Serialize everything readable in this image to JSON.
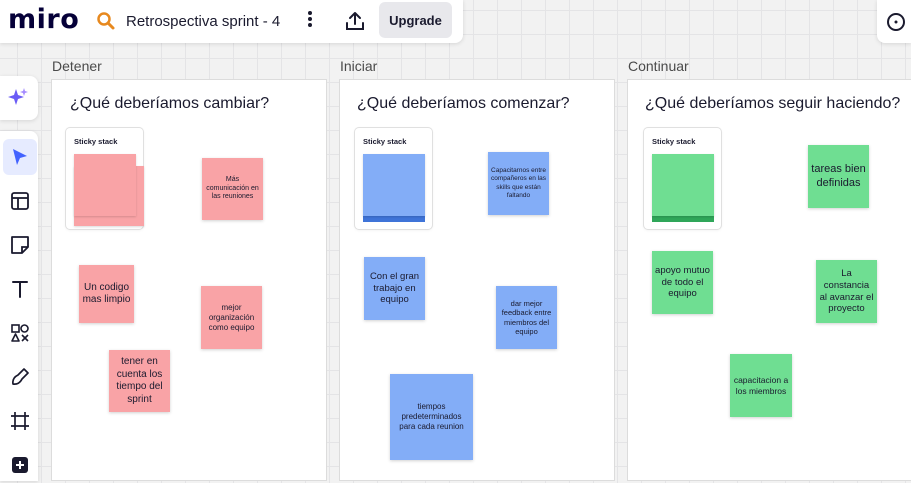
{
  "topbar": {
    "logo": "miro",
    "board_title": "Retrospectiva sprint - 4",
    "upgrade_label": "Upgrade"
  },
  "columns": [
    {
      "label": "Detener",
      "title": "¿Qué deberíamos cambiar?",
      "stack_label": "Sticky stack",
      "notes": [
        "Más comunicación en las reuniones",
        "Un codigo mas limpio",
        "mejor organización como equipo",
        "tener en cuenta los tiempo del sprint"
      ]
    },
    {
      "label": "Iniciar",
      "title": "¿Qué deberíamos comenzar?",
      "stack_label": "Sticky stack",
      "notes": [
        "Capacitarnos entre compañeros en las skills que están faltando",
        "Con el gran trabajo en equipo",
        "dar mejor feedback entre miembros del equipo",
        "tiempos predeterminados para cada reunion"
      ]
    },
    {
      "label": "Continuar",
      "title": "¿Qué deberíamos seguir haciendo?",
      "stack_label": "Sticky stack",
      "notes": [
        "tareas bien definidas",
        "apoyo mutuo de todo el equipo",
        "La constancia al avanzar el proyecto",
        "capacitacion a los miembros"
      ]
    }
  ],
  "colors": {
    "pink": "#f9a3a6",
    "blue": "#83adf7",
    "green": "#6fde92",
    "accent": "#4262ff"
  }
}
